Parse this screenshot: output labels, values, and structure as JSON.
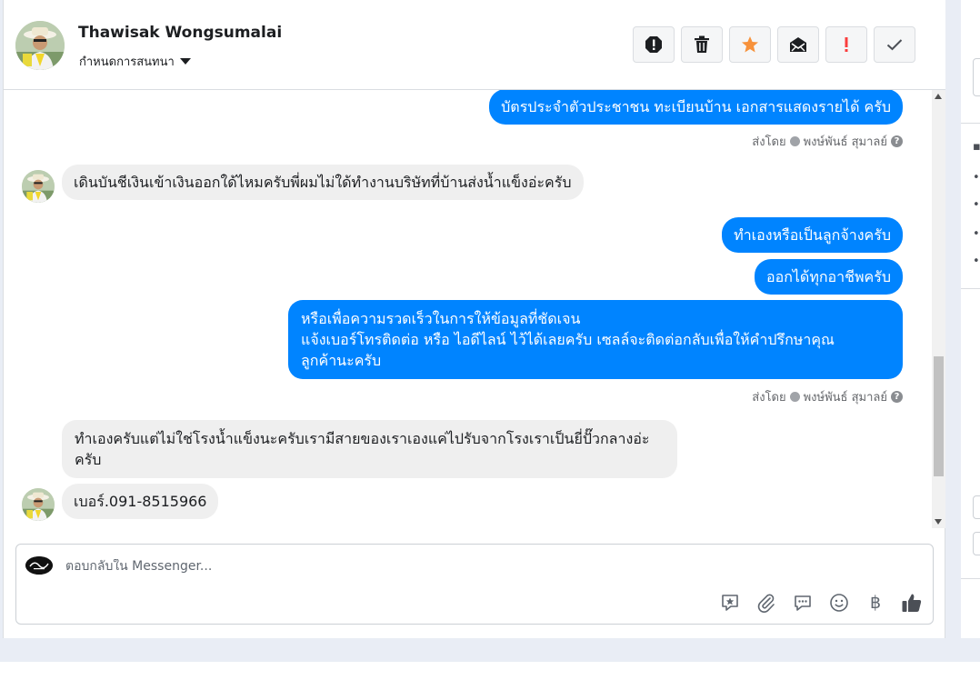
{
  "header": {
    "contact_name": "Thawisak Wongsumalai",
    "assign_label": "กำหนดการสนทนา",
    "actions": [
      {
        "icon": "alert-circle-icon",
        "label": "spam"
      },
      {
        "icon": "trash-icon",
        "label": "delete"
      },
      {
        "icon": "star-icon",
        "label": "star"
      },
      {
        "icon": "mark-unread-icon",
        "label": "unread"
      },
      {
        "icon": "exclamation-icon",
        "label": "important"
      },
      {
        "icon": "checkmark-icon",
        "label": "done"
      }
    ]
  },
  "messages": [
    {
      "side": "out",
      "text": "บัตรประจำตัวประชาชน ทะเบียนบ้าน เอกสารแสดงรายได้ ครับ"
    },
    {
      "side": "in",
      "text": "เดินบันชีเงินเข้าเงินออกใด้ไหมครับพี่ผมไม่ใด้ทำงานบริษัทที่บ้านส่งน้ำแข็งอ่ะครับ"
    },
    {
      "side": "out",
      "text": "ทำเองหรือเป็นลูกจ้างครับ"
    },
    {
      "side": "out",
      "text": "ออกได้ทุกอาชีพครับ"
    },
    {
      "side": "out",
      "lines": [
        "หรือเพื่อความรวดเร็วในการให้ข้อมูลที่ชัดเจน",
        "แจ้งเบอร์โทรติดต่อ หรือ ไอดีไลน์ ไว้ได้เลยครับ เซลล์จะติดต่อกลับเพื่อให้คำปรึกษาคุณ",
        "ลูกค้านะครับ"
      ]
    },
    {
      "side": "in",
      "lines": [
        "ทำเองครับแต่ไม่ใช่โรงน้ำแข็งนะครับเรามีสายของเราเองแค่ไปรับจากโรงเราเป็นยี่ปั๊วกลางอ่ะ",
        "ครับ"
      ]
    },
    {
      "side": "in",
      "text": "เบอร์.091-8515966"
    }
  ],
  "sent_by": {
    "prefix": "ส่งโดย",
    "agent": "พงษ์พันธ์ สุมาลย์"
  },
  "composer": {
    "placeholder": "ตอบกลับใน Messenger...",
    "icons": [
      "saved-reply-icon",
      "attachment-icon",
      "chat-bubble-icon",
      "emoji-icon",
      "baht-icon",
      "thumbs-up-icon"
    ],
    "baht_symbol": "฿"
  },
  "colors": {
    "outgoing_bubble": "#0084ff",
    "incoming_bubble": "#efefef",
    "star": "#f7923b",
    "important": "#fa3e3e"
  }
}
